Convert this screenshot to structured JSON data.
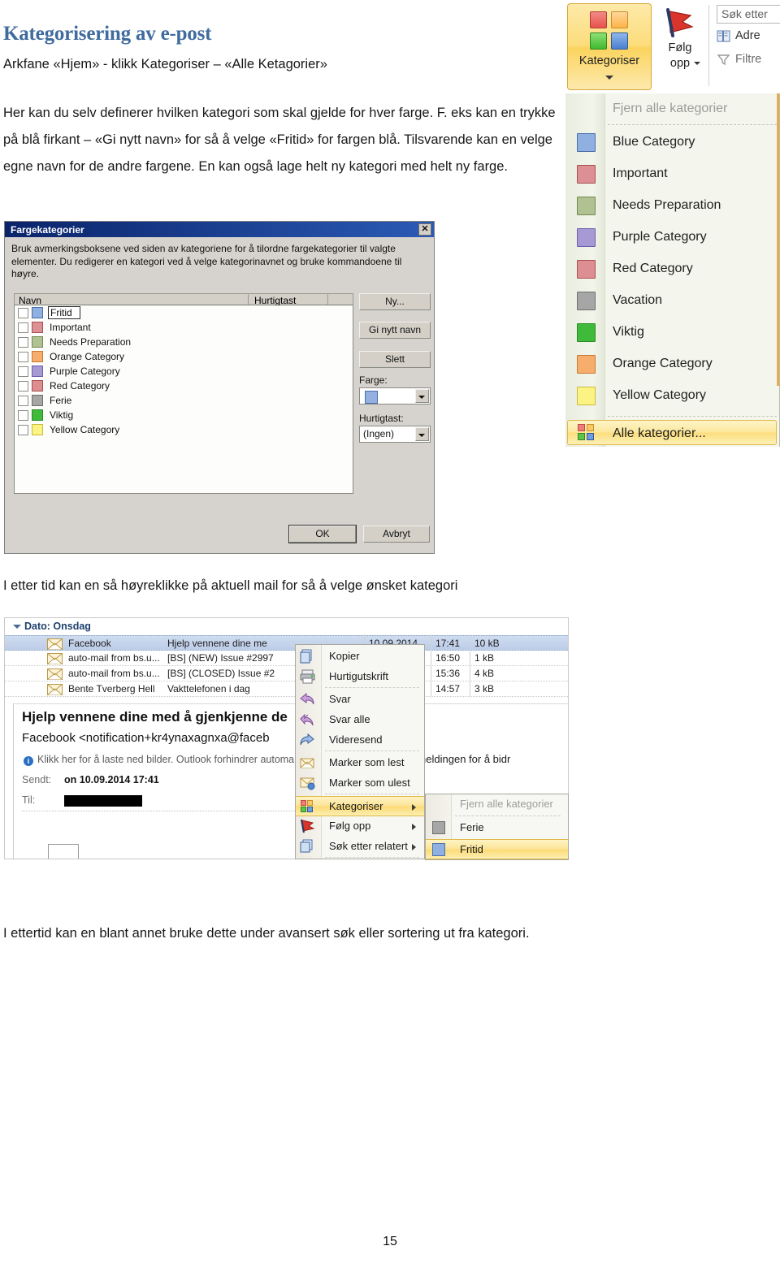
{
  "document": {
    "title": "Kategorisering av e-post",
    "subtitle": "Arkfane «Hjem» - klikk Kategoriser – «Alle Ketagorier»",
    "paragraph1": "Her kan du selv definerer hvilken kategori som skal gjelde for hver farge. F. eks kan en trykke på blå firkant – «Gi nytt navn» for så å velge «Fritid» for fargen blå. Tilsvarende kan en velge egne navn for de andre fargene. En kan også lage helt ny kategori med helt ny farge.",
    "paragraph2": "I etter tid kan en så høyreklikke på aktuell mail for så å velge ønsket kategori",
    "paragraph3": "I ettertid kan en blant annet bruke dette under avansert søk eller sortering ut fra kategori.",
    "page_number": "15",
    "title_color": "#3f6b9e"
  },
  "ribbon": {
    "categorize_label": "Kategoriser",
    "followup_label_line1": "Følg",
    "followup_label_line2": "opp",
    "search_placeholder": "Søk etter",
    "address_label": "Adre",
    "filter_label": "Filtre"
  },
  "categorize_dropdown": {
    "clear_all_label": "Fjern alle kategorier",
    "all_categories_label": "Alle kategorier...",
    "items": [
      {
        "label": "Blue Category",
        "color": "#8fb0e0",
        "border": "#4a6fa8"
      },
      {
        "label": "Important",
        "color": "#dd9093",
        "border": "#a84f53"
      },
      {
        "label": "Needs Preparation",
        "color": "#b0c192",
        "border": "#75884f"
      },
      {
        "label": "Purple Category",
        "color": "#a79ad4",
        "border": "#6d5fa8"
      },
      {
        "label": "Red Category",
        "color": "#dd8e90",
        "border": "#a84f53"
      },
      {
        "label": "Vacation",
        "color": "#a6a6a6",
        "border": "#6f6f6f"
      },
      {
        "label": "Viktig",
        "color": "#3fba3a",
        "border": "#2b8a26"
      },
      {
        "label": "Orange Category",
        "color": "#f7ad6c",
        "border": "#c87a30"
      },
      {
        "label": "Yellow Category",
        "color": "#fbf384",
        "border": "#ccbb3b"
      }
    ]
  },
  "dialog": {
    "title": "Fargekategorier",
    "close_label": "✕",
    "instructions": "Bruk avmerkingsboksene ved siden av kategoriene for å tilordne fargekategorier til valgte elementer. Du redigerer en kategori ved å velge kategorinavnet og bruke kommandoene til høyre.",
    "col_name": "Navn",
    "col_shortcut": "Hurtigtast",
    "buttons": {
      "new": "Ny...",
      "rename": "Gi nytt navn",
      "delete": "Slett",
      "ok": "OK",
      "cancel": "Avbryt"
    },
    "labels": {
      "color": "Farge:",
      "shortcut": "Hurtigtast:"
    },
    "shortcut_value": "(Ingen)",
    "color_value_hex": "#93b0e0",
    "categories": [
      {
        "name": "Fritid",
        "color": "#8fb0e0",
        "border": "#4a6fa8",
        "editing": true
      },
      {
        "name": "Important",
        "color": "#dd9093",
        "border": "#a84f53",
        "editing": false
      },
      {
        "name": "Needs Preparation",
        "color": "#b0c192",
        "border": "#75884f",
        "editing": false
      },
      {
        "name": "Orange Category",
        "color": "#f7ad6c",
        "border": "#c87a30",
        "editing": false
      },
      {
        "name": "Purple Category",
        "color": "#a79ad4",
        "border": "#6d5fa8",
        "editing": false
      },
      {
        "name": "Red Category",
        "color": "#dd8e90",
        "border": "#a84f53",
        "editing": false
      },
      {
        "name": "Ferie",
        "color": "#a6a6a6",
        "border": "#6f6f6f",
        "editing": false
      },
      {
        "name": "Viktig",
        "color": "#3fba3a",
        "border": "#2b8a26",
        "editing": false
      },
      {
        "name": "Yellow Category",
        "color": "#fbf384",
        "border": "#ccbb3b",
        "editing": false
      }
    ]
  },
  "mail": {
    "group_header": "Dato: Onsdag",
    "rows": [
      {
        "from": "Facebook",
        "subject": "Hjelp vennene dine me",
        "date": "10.09.2014",
        "time": "17:41",
        "size": "10 kB",
        "selected": true
      },
      {
        "from": "auto-mail from bs.u...",
        "subject": "[BS] (NEW) Issue #2997",
        "date": "",
        "time": "16:50",
        "size": "1 kB",
        "selected": false
      },
      {
        "from": "auto-mail from bs.u...",
        "subject": "[BS] (CLOSED) Issue #2",
        "date": "",
        "time": "15:36",
        "size": "4 kB",
        "selected": false
      },
      {
        "from": "Bente Tverberg Hell",
        "subject": "Vakttelefonen i dag",
        "date": "",
        "time": "14:57",
        "size": "3 kB",
        "selected": false
      }
    ],
    "reading_pane": {
      "subject": "Hjelp vennene dine med å gjenkjenne de",
      "sender": "Facebook <notification+kr4ynaxagnxa@faceb",
      "info_bar": "Klikk her for å laste ned bilder. Outlook forhindrer automa",
      "info_icon": "i",
      "sent_label": "Sendt:",
      "sent_value": "on 10.09.2014 17:41",
      "to_label": "Til:",
      "to_value": "",
      "body_fragment": "er i denne meldingen for å bidr"
    }
  },
  "context_menu": {
    "items": [
      {
        "label": "Kopier",
        "icon": "copy-icon",
        "submenu": false,
        "highlighted": false
      },
      {
        "label": "Hurtigutskrift",
        "icon": "print-icon",
        "submenu": false,
        "highlighted": false
      },
      {
        "label": "Svar",
        "icon": "reply-icon",
        "submenu": false,
        "highlighted": false
      },
      {
        "label": "Svar alle",
        "icon": "reply-all-icon",
        "submenu": false,
        "highlighted": false
      },
      {
        "label": "Videresend",
        "icon": "forward-icon",
        "submenu": false,
        "highlighted": false
      },
      {
        "label": "Marker som lest",
        "icon": "mail-open-icon",
        "submenu": false,
        "highlighted": false
      },
      {
        "label": "Marker som ulest",
        "icon": "mail-unread-icon",
        "submenu": false,
        "highlighted": false
      },
      {
        "label": "Kategoriser",
        "icon": "categories-icon",
        "submenu": true,
        "highlighted": true
      },
      {
        "label": "Følg opp",
        "icon": "flag-icon",
        "submenu": true,
        "highlighted": false
      },
      {
        "label": "Søk etter relatert",
        "icon": "related-icon",
        "submenu": true,
        "highlighted": false
      }
    ]
  },
  "context_submenu": {
    "clear_all_label": "Fjern alle kategorier",
    "items": [
      {
        "label": "Ferie",
        "color": "#a6a6a6",
        "border": "#6f6f6f",
        "highlighted": false
      },
      {
        "label": "Fritid",
        "color": "#8fb0e0",
        "border": "#4a6fa8",
        "highlighted": true
      }
    ]
  }
}
